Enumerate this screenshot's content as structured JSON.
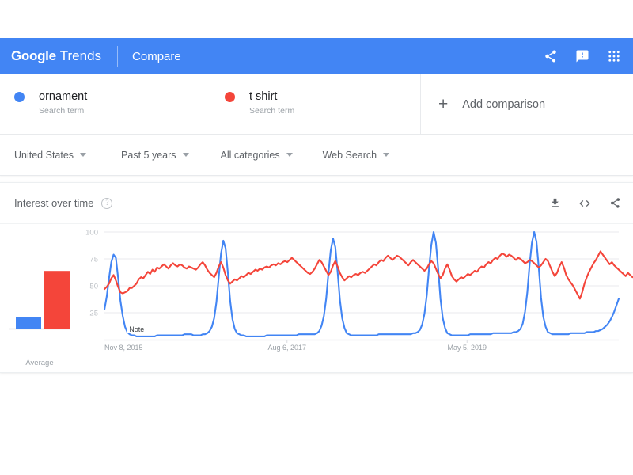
{
  "header": {
    "brand_google": "Google",
    "brand_trends": "Trends",
    "section": "Compare",
    "icons": [
      {
        "name": "share-icon",
        "label": "Share"
      },
      {
        "name": "feedback-icon",
        "label": "Send feedback"
      },
      {
        "name": "apps-grid-icon",
        "label": "Google apps"
      }
    ]
  },
  "terms": [
    {
      "name": "ornament",
      "subtitle": "Search term",
      "color": "#4285f4"
    },
    {
      "name": "t shirt",
      "subtitle": "Search term",
      "color": "#f4453a"
    }
  ],
  "add_comparison": {
    "plus": "+",
    "label": "Add comparison"
  },
  "filters": [
    {
      "label": "United States",
      "name": "filter-location"
    },
    {
      "label": "Past 5 years",
      "name": "filter-time-range"
    },
    {
      "label": "All categories",
      "name": "filter-category"
    },
    {
      "label": "Web Search",
      "name": "filter-search-type"
    }
  ],
  "interest_card": {
    "title": "Interest over time",
    "help": "?",
    "icons": [
      {
        "name": "download-icon",
        "label": "Download CSV"
      },
      {
        "name": "embed-icon",
        "label": "Embed"
      },
      {
        "name": "share-icon",
        "label": "Share"
      }
    ],
    "average_label": "Average",
    "note_label": "Note"
  },
  "colors": {
    "header_blue": "#4285f4",
    "series_blue": "#4285f4",
    "series_red": "#f4453a",
    "grid": "#e8eaed",
    "text_secondary": "#5f6368",
    "text_muted": "#9aa0a6"
  },
  "chart_data": {
    "type": "line",
    "title": "Interest over time",
    "xlabel": "",
    "ylabel": "Interest",
    "ylim": [
      0,
      100
    ],
    "yticks": [
      25,
      50,
      75,
      100
    ],
    "grid": true,
    "legend_position": "top-cards",
    "xticks": [
      "Nov 8, 2015",
      "Aug 6, 2017",
      "May 5, 2019"
    ],
    "xtick_positions": [
      0.0,
      0.355,
      0.705
    ],
    "annotations": [
      {
        "text": "Note",
        "x": 0.045,
        "y": 4
      }
    ],
    "average_bars": {
      "label": "Average",
      "categories": [
        "ornament",
        "t shirt"
      ],
      "values": [
        13,
        65
      ]
    },
    "series": [
      {
        "name": "ornament",
        "color": "#4285f4",
        "values": [
          28,
          40,
          57,
          72,
          79,
          76,
          57,
          36,
          22,
          12,
          7,
          5,
          4,
          4,
          3,
          3,
          3,
          3,
          3,
          3,
          3,
          3,
          3,
          4,
          4,
          4,
          4,
          4,
          4,
          4,
          4,
          4,
          4,
          4,
          4,
          5,
          5,
          5,
          5,
          4,
          4,
          4,
          4,
          5,
          5,
          6,
          8,
          12,
          20,
          35,
          58,
          80,
          92,
          85,
          62,
          36,
          19,
          10,
          6,
          5,
          4,
          4,
          3,
          3,
          3,
          3,
          3,
          3,
          3,
          3,
          3,
          4,
          4,
          4,
          4,
          4,
          4,
          4,
          4,
          4,
          4,
          4,
          4,
          4,
          4,
          5,
          5,
          5,
          5,
          5,
          5,
          5,
          5,
          6,
          8,
          13,
          22,
          38,
          62,
          83,
          94,
          86,
          63,
          37,
          20,
          11,
          6,
          5,
          4,
          4,
          4,
          4,
          4,
          4,
          4,
          4,
          4,
          4,
          4,
          4,
          5,
          5,
          5,
          5,
          5,
          5,
          5,
          5,
          5,
          5,
          5,
          5,
          5,
          5,
          5,
          6,
          6,
          7,
          9,
          14,
          24,
          41,
          66,
          88,
          100,
          90,
          66,
          38,
          20,
          11,
          6,
          5,
          4,
          4,
          4,
          4,
          4,
          4,
          4,
          4,
          5,
          5,
          5,
          5,
          5,
          5,
          5,
          5,
          5,
          5,
          6,
          6,
          6,
          6,
          6,
          6,
          6,
          6,
          6,
          7,
          7,
          8,
          10,
          15,
          26,
          44,
          70,
          90,
          100,
          91,
          67,
          39,
          21,
          12,
          7,
          6,
          5,
          5,
          5,
          5,
          5,
          5,
          5,
          5,
          6,
          6,
          6,
          6,
          6,
          6,
          6,
          7,
          7,
          7,
          7,
          8,
          8,
          9,
          10,
          12,
          14,
          17,
          21,
          26,
          32,
          38
        ]
      },
      {
        "name": "t shirt",
        "color": "#f4453a",
        "values": [
          47,
          49,
          52,
          57,
          60,
          55,
          49,
          44,
          43,
          44,
          45,
          48,
          48,
          50,
          52,
          56,
          58,
          57,
          60,
          63,
          61,
          65,
          63,
          67,
          66,
          68,
          70,
          68,
          66,
          69,
          71,
          69,
          68,
          70,
          69,
          67,
          66,
          68,
          67,
          66,
          65,
          67,
          70,
          72,
          69,
          65,
          62,
          60,
          58,
          62,
          68,
          72,
          67,
          60,
          55,
          52,
          54,
          56,
          55,
          57,
          59,
          58,
          60,
          62,
          61,
          63,
          65,
          64,
          66,
          65,
          67,
          68,
          67,
          69,
          70,
          69,
          71,
          70,
          72,
          73,
          72,
          74,
          76,
          74,
          72,
          70,
          68,
          66,
          64,
          62,
          61,
          63,
          66,
          70,
          74,
          72,
          68,
          64,
          60,
          63,
          69,
          73,
          68,
          62,
          58,
          55,
          57,
          59,
          58,
          60,
          61,
          60,
          62,
          63,
          62,
          64,
          66,
          68,
          70,
          69,
          72,
          74,
          73,
          76,
          78,
          76,
          74,
          76,
          78,
          77,
          75,
          73,
          71,
          69,
          72,
          74,
          72,
          70,
          68,
          66,
          64,
          66,
          70,
          73,
          71,
          66,
          61,
          57,
          60,
          66,
          70,
          65,
          59,
          56,
          54,
          56,
          58,
          57,
          59,
          61,
          60,
          62,
          64,
          63,
          66,
          68,
          67,
          70,
          72,
          71,
          74,
          76,
          75,
          78,
          80,
          79,
          77,
          79,
          78,
          76,
          74,
          76,
          75,
          73,
          71,
          72,
          74,
          73,
          71,
          69,
          67,
          69,
          72,
          75,
          73,
          68,
          63,
          59,
          62,
          68,
          72,
          67,
          60,
          56,
          53,
          50,
          46,
          42,
          38,
          44,
          52,
          58,
          63,
          67,
          71,
          74,
          78,
          82,
          79,
          76,
          73,
          70,
          72,
          69,
          67,
          65,
          63,
          61,
          59,
          62,
          60,
          58
        ]
      }
    ]
  }
}
